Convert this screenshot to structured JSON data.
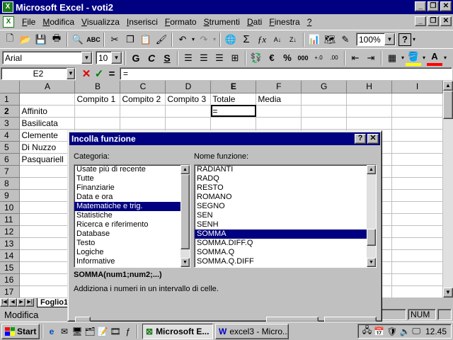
{
  "window": {
    "title": "Microsoft Excel - voti2",
    "app_icon": "excel-icon",
    "controls": [
      "_",
      "❐",
      "✕"
    ]
  },
  "menubar": {
    "items": [
      {
        "label": "File",
        "u": "F",
        "rest": "ile"
      },
      {
        "label": "Modifica",
        "u": "M",
        "rest": "odifica"
      },
      {
        "label": "Visualizza",
        "u": "V",
        "rest": "isualizza"
      },
      {
        "label": "Inserisci",
        "u": "I",
        "rest": "nserisci"
      },
      {
        "label": "Formato",
        "u": "F",
        "rest": "ormato"
      },
      {
        "label": "Strumenti",
        "u": "S",
        "rest": "trumenti"
      },
      {
        "label": "Dati",
        "u": "D",
        "rest": "ati"
      },
      {
        "label": "Finestra",
        "u": "F",
        "rest": "inestra"
      },
      {
        "label": "?",
        "u": "?",
        "rest": ""
      }
    ]
  },
  "toolbar1": {
    "zoom": "100%",
    "help": "?"
  },
  "toolbar2": {
    "font": "Arial",
    "size": "10",
    "bold": "G",
    "italic": "C",
    "underline": "S",
    "currency": "€",
    "percent": "%",
    "thousands": "000"
  },
  "formulabar": {
    "namebox": "E2",
    "cancel": "✕",
    "enter": "✓",
    "equals": "=",
    "content": "="
  },
  "sheet": {
    "columns": [
      "A",
      "B",
      "C",
      "D",
      "E",
      "F",
      "G",
      "H",
      "I"
    ],
    "row_numbers": [
      "1",
      "2",
      "3",
      "4",
      "5",
      "6",
      "7",
      "8",
      "9",
      "10",
      "11",
      "12",
      "13",
      "14",
      "15",
      "16",
      "17"
    ],
    "header_row": [
      "",
      "Compito 1",
      "Compito 2",
      "Compito 3",
      "Totale",
      "Media",
      "",
      "",
      ""
    ],
    "names": [
      "Affinito",
      "Basilicata",
      "Clemente",
      "Di Nuzzo",
      "Pasquariell"
    ],
    "active_cell_value": "=",
    "tab": "Foglio1"
  },
  "dialog": {
    "title": "Incolla funzione",
    "help_btn": "?",
    "close_btn": "✕",
    "category_label": "Categoria:",
    "function_label": "Nome funzione:",
    "categories": [
      "Usate più di recente",
      "Tutte",
      "Finanziarie",
      "Data e ora",
      "Matematiche e trig.",
      "Statistiche",
      "Ricerca e riferimento",
      "Database",
      "Testo",
      "Logiche",
      "Informative"
    ],
    "selected_category": 4,
    "functions": [
      "RADIANTI",
      "RADQ",
      "RESTO",
      "ROMANO",
      "SEGNO",
      "SEN",
      "SENH",
      "SOMMA",
      "SOMMA.DIFF.Q",
      "SOMMA.Q",
      "SOMMA.Q.DIFF"
    ],
    "selected_function": 7,
    "syntax": "SOMMA(num1;num2;...)",
    "description": "Addiziona i numeri in un intervallo di celle."
  },
  "statusbar": {
    "text": "Modifica",
    "num": "NUM"
  },
  "taskbar": {
    "start": "Start",
    "tasks": [
      {
        "label": "Microsoft E...",
        "active": true
      },
      {
        "label": "excel3 - Micro...",
        "active": false
      }
    ],
    "clock": "12.45"
  },
  "colors": {
    "titlebar": "#000080",
    "face": "#c0c0c0",
    "desktop": "#008080",
    "selection": "#000080"
  }
}
